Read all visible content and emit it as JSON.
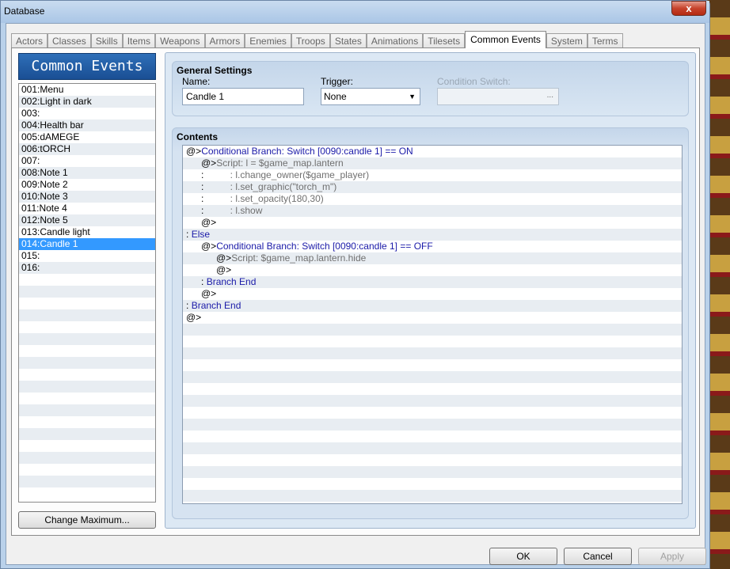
{
  "window": {
    "title": "Database",
    "close_label": "x"
  },
  "tabs": [
    "Actors",
    "Classes",
    "Skills",
    "Items",
    "Weapons",
    "Armors",
    "Enemies",
    "Troops",
    "States",
    "Animations",
    "Tilesets",
    "Common Events",
    "System",
    "Terms"
  ],
  "active_tab": "Common Events",
  "left_panel": {
    "header": "Common Events",
    "events": [
      "001:Menu",
      "002:Light in dark",
      "003:",
      "004:Health bar",
      "005:dAMEGE",
      "006:tORCH",
      "007:",
      "008:Note 1",
      "009:Note 2",
      "010:Note 3",
      "011:Note 4",
      "012:Note 5",
      "013:Candle light",
      "014:Candle 1",
      "015:",
      "016:"
    ],
    "selected": "014:Candle 1",
    "change_max_button": "Change Maximum..."
  },
  "general_settings": {
    "title": "General Settings",
    "name_label": "Name:",
    "name_value": "Candle 1",
    "trigger_label": "Trigger:",
    "trigger_value": "None",
    "condition_label": "Condition Switch:",
    "condition_button": "..."
  },
  "contents": {
    "title": "Contents",
    "lines": [
      {
        "indent": 0,
        "prefix": "@>",
        "text": "Conditional Branch: Switch [0090:candle 1] == ON",
        "kind": "branch"
      },
      {
        "indent": 1,
        "prefix": "@>",
        "text": "Script: l = $game_map.lantern",
        "kind": "script"
      },
      {
        "indent": 1,
        "prefix": " :",
        "text": "          : l.change_owner($game_player)",
        "kind": "script"
      },
      {
        "indent": 1,
        "prefix": " :",
        "text": "          : l.set_graphic(\"torch_m\")",
        "kind": "script"
      },
      {
        "indent": 1,
        "prefix": " :",
        "text": "          : l.set_opacity(180,30)",
        "kind": "script"
      },
      {
        "indent": 1,
        "prefix": " :",
        "text": "          : l.show",
        "kind": "script"
      },
      {
        "indent": 1,
        "prefix": "@>",
        "text": "",
        "kind": "at"
      },
      {
        "indent": 0,
        "prefix": " :",
        "text": "Else",
        "kind": "else"
      },
      {
        "indent": 1,
        "prefix": "@>",
        "text": "Conditional Branch: Switch [0090:candle 1] == OFF",
        "kind": "branch"
      },
      {
        "indent": 2,
        "prefix": "@>",
        "text": "Script: $game_map.lantern.hide",
        "kind": "script"
      },
      {
        "indent": 2,
        "prefix": "@>",
        "text": "",
        "kind": "at"
      },
      {
        "indent": 1,
        "prefix": " :",
        "text": "Branch End",
        "kind": "else"
      },
      {
        "indent": 1,
        "prefix": "@>",
        "text": "",
        "kind": "at"
      },
      {
        "indent": 0,
        "prefix": " :",
        "text": "Branch End",
        "kind": "else"
      },
      {
        "indent": 0,
        "prefix": "@>",
        "text": "",
        "kind": "at"
      }
    ]
  },
  "footer": {
    "ok": "OK",
    "cancel": "Cancel",
    "apply": "Apply"
  }
}
